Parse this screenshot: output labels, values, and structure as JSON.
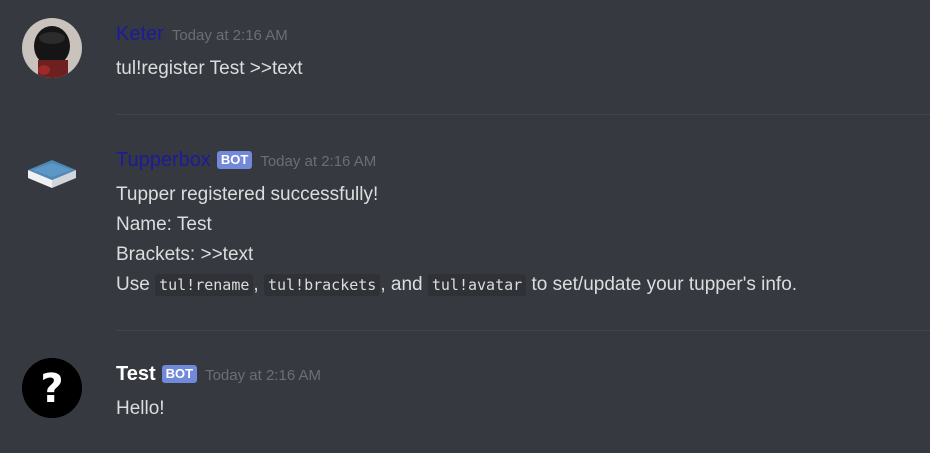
{
  "messages": [
    {
      "username": "Keter",
      "timestamp": "Today at 2:16 AM",
      "avatar_icon": "person-avatar",
      "lines": [
        "tul!register Test >>text"
      ]
    },
    {
      "username": "Tupperbox",
      "bot_tag": "BOT",
      "timestamp": "Today at 2:16 AM",
      "avatar_icon": "tupperware-box-icon",
      "lines": [
        "Tupper registered successfully!",
        "Name: Test",
        "Brackets: >>text"
      ],
      "usage_line": {
        "prefix": "Use ",
        "cmd1": "tul!rename",
        "sep1": ",",
        "cmd2": "tul!brackets",
        "sep2": ", and ",
        "cmd3": "tul!avatar",
        "suffix": " to set/update your tupper's info."
      }
    },
    {
      "username": "Test",
      "bot_tag": "BOT",
      "timestamp": "Today at 2:16 AM",
      "avatar_icon": "question-mark-icon",
      "lines": [
        "Hello!"
      ]
    }
  ],
  "colors": {
    "background": "#36393f",
    "bot_tag": "#7289da",
    "username_link": "#1b1b9c",
    "timestamp": "#6b6e74",
    "text": "#dcddde"
  }
}
